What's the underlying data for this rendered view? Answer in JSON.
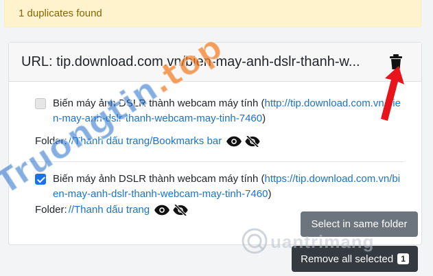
{
  "alert": {
    "text": "1 duplicates found"
  },
  "card": {
    "url_text": "URL: tip.download.com.vn/bien-may-anh-dslr-thanh-w...",
    "entries": [
      {
        "title": "Biến máy ảnh DSLR thành webcam máy tính",
        "link": "http://tip.download.com.vn/bien-may-anh-dslr-thanh-webcam-may-tinh-7460",
        "folder_label": "Folder:",
        "folder_path": "//Thanh dấu trang/Bookmarks bar",
        "checked": false
      },
      {
        "title": "Biến máy ảnh DSLR thành webcam máy tính",
        "link": "https://tip.download.com.vn/bien-may-anh-dslr-thanh-webcam-may-tinh-7460",
        "folder_label": "Folder:",
        "folder_path": "//Thanh dấu trang",
        "checked": true
      }
    ]
  },
  "buttons": {
    "select_same_folder": "Select in same folder",
    "remove_all_selected": "Remove all selected",
    "selected_count": "1"
  },
  "watermark": {
    "text_main": "Truongtin",
    "text_dot": ".top",
    "brand": "uantrimang"
  },
  "icons": {
    "trash": "trash-icon",
    "eye": "eye-icon",
    "eye_slash": "eye-slash-icon",
    "arrow": "arrow-icon"
  },
  "colors": {
    "alert_bg": "#fff3cd",
    "link": "#1a73c8",
    "checkbox_checked": "#1b72e8",
    "button_secondary": "#6c757d",
    "button_dark": "#343a40",
    "arrow_red": "#e8141b"
  }
}
